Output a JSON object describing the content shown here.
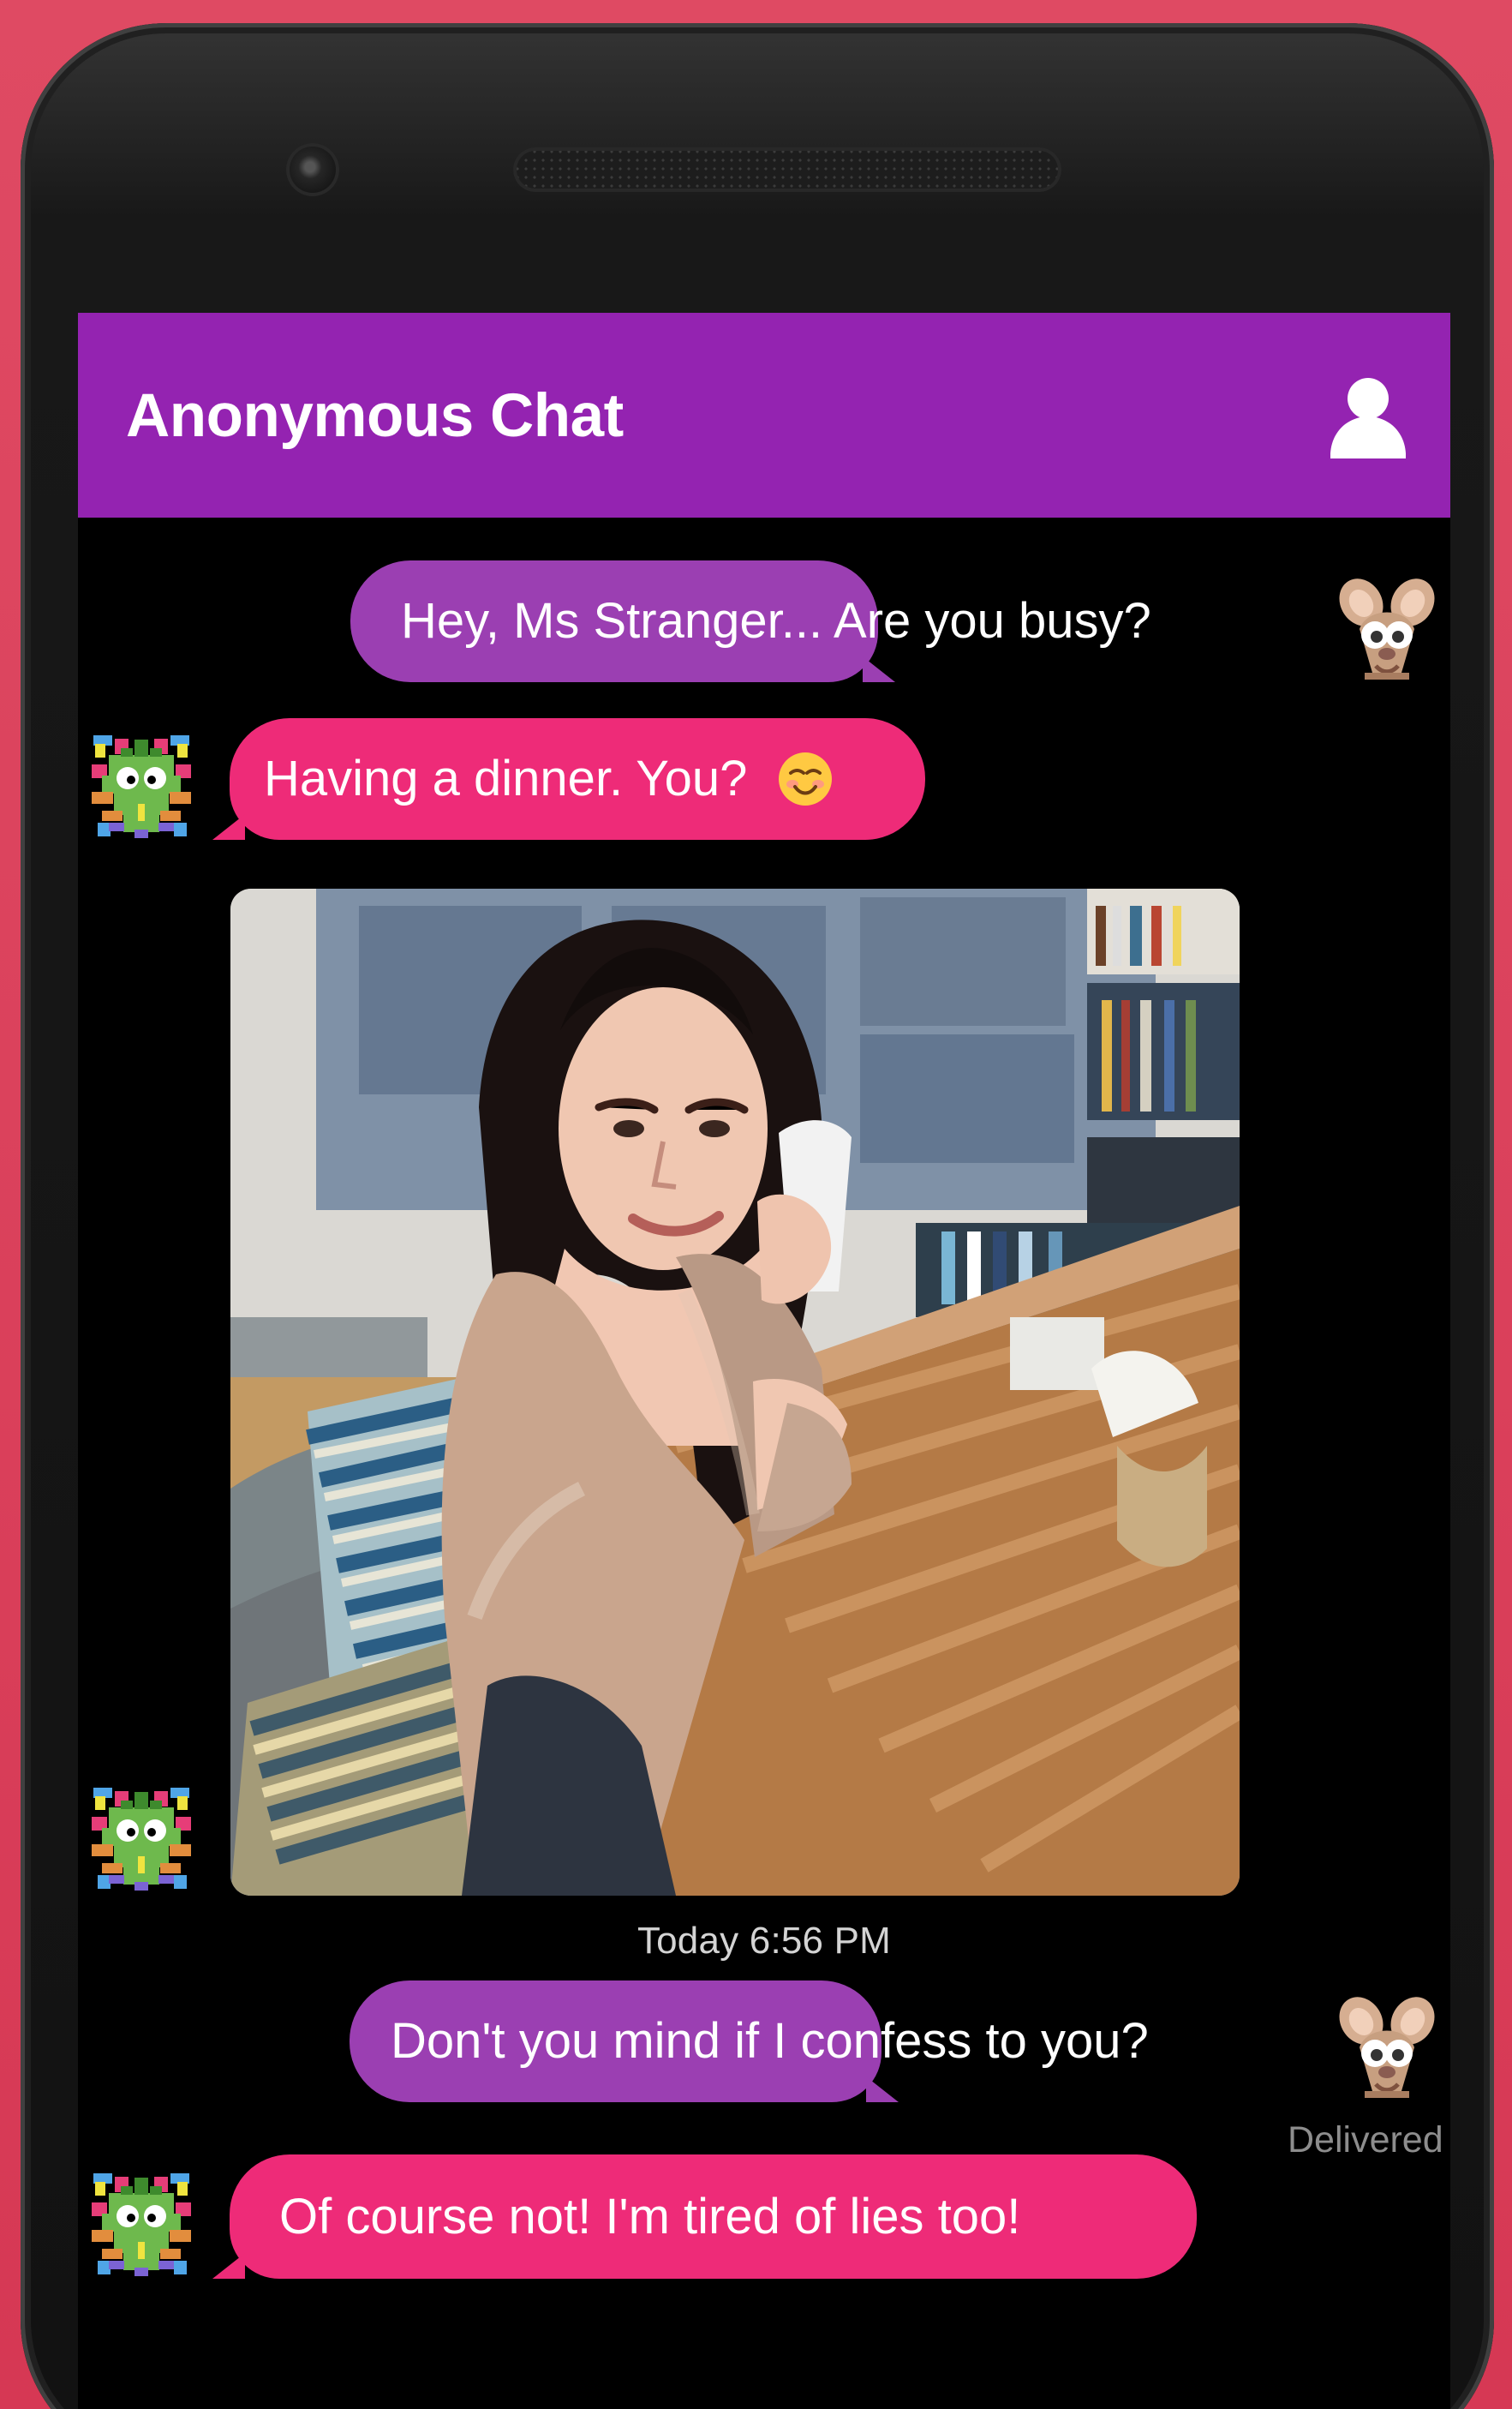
{
  "app": {
    "title": "Anonymous Chat"
  },
  "messages": [
    {
      "direction": "outgoing",
      "text": "Hey, Ms Stranger... Are you busy?"
    },
    {
      "direction": "incoming",
      "text": "Having a dinner. You?",
      "emoji": "smiling-face"
    },
    {
      "direction": "incoming",
      "type": "photo",
      "photo_description": ""
    },
    {
      "direction": "outgoing",
      "text": "Don't you mind if I confess to you?"
    },
    {
      "direction": "incoming",
      "text": "Of course not! I'm tired of lies too!"
    }
  ],
  "timestamp": "Today 6:56 PM",
  "status": "Delivered",
  "icons": {
    "profile": "person-icon",
    "self_avatar": "mouse-avatar-icon",
    "partner_avatar": "pixel-bug-avatar-icon"
  },
  "colors": {
    "background": "#d83e5a",
    "app_bar": "#9423b1",
    "outgoing_bubble": "#9b3fb2",
    "incoming_bubble": "#ee2b78",
    "screen": "#000000"
  }
}
